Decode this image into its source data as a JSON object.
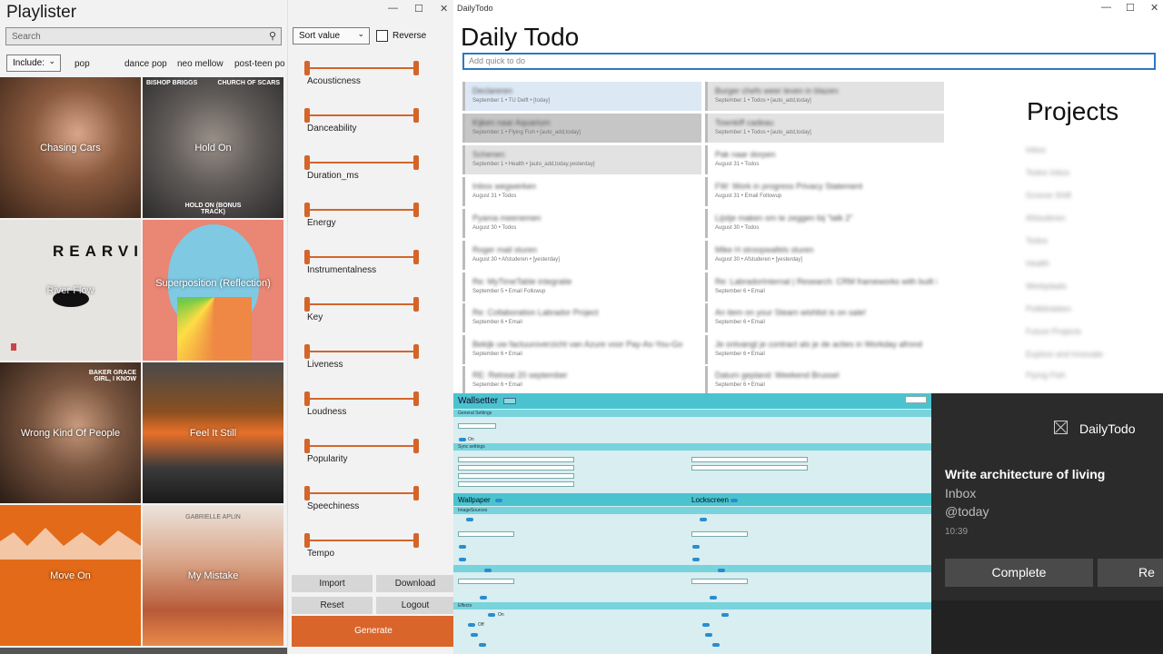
{
  "playlister": {
    "title": "Playlister",
    "search_placeholder": "Search",
    "include_label": "Include:",
    "genres": [
      "pop",
      "dance pop",
      "neo mellow",
      "post-teen po"
    ],
    "tiles": [
      {
        "label": "Chasing Cars"
      },
      {
        "label": "Hold On",
        "top_left": "BISHOP BRIGGS",
        "top_right": "CHURCH OF SCARS",
        "bottom": "HOLD ON (BONUS TRACK)"
      },
      {
        "label": "River Flow",
        "art": "REARVIO"
      },
      {
        "label": "Superposition (Reflection)"
      },
      {
        "label": "Wrong Kind Of People",
        "top_right": "BAKER GRACE GIRL, I KNOW"
      },
      {
        "label": "Feel It Still"
      },
      {
        "label": "Move On"
      },
      {
        "label": "My Mistake",
        "top": "GABRIELLE APLIN"
      }
    ]
  },
  "sortpanel": {
    "sort_value": "Sort value",
    "reverse_label": "Reverse",
    "sliders": [
      "Acousticness",
      "Danceability",
      "Duration_ms",
      "Energy",
      "Instrumentalness",
      "Key",
      "Liveness",
      "Loudness",
      "Popularity",
      "Speechiness",
      "Tempo"
    ],
    "buttons": {
      "import": "Import",
      "download": "Download",
      "reset": "Reset",
      "logout": "Logout",
      "generate": "Generate"
    }
  },
  "dailytodo": {
    "window_title": "DailyTodo",
    "title": "Daily Todo",
    "quick_placeholder": "Add quick to do",
    "projects_title": "Projects",
    "left_todos": [
      {
        "title": "Declareren",
        "meta": "September 1 • TU Delft • [today]"
      },
      {
        "title": "Kijken naar Aquarium",
        "meta": "September 1 • Flying Fish • [auto_add,today]"
      },
      {
        "title": "Schenen",
        "meta": "September 1 • Health • [auto_add,today,yesterday]"
      },
      {
        "title": "Inbox wegwerken",
        "meta": "August 31 • Todos"
      },
      {
        "title": "Pyama meenemen",
        "meta": "August 30 • Todos"
      },
      {
        "title": "Roger mail sturen",
        "meta": "August 30 • Afstuderen • [yesterday]"
      },
      {
        "title": "Re: MyTimeTable integratie",
        "meta": "September 5 • Email Followup"
      },
      {
        "title": "Re: Collaboration Labrador Project",
        "meta": "September 6 • Email"
      },
      {
        "title": "Bekijk uw factuuroverzicht van Azure voor Pay-As-You-Go",
        "meta": "September 6 • Email"
      },
      {
        "title": "RE: Retreat 20 september",
        "meta": "September 6 • Email"
      }
    ],
    "right_todos": [
      {
        "title": "Burger chefs weer leven in blazen",
        "meta": "September 1 • Todos • [auto_add,today]"
      },
      {
        "title": "Townkiff cadeau",
        "meta": "September 1 • Todos • [auto_add,today]"
      },
      {
        "title": "Pak naar dorpen",
        "meta": "August 31 • Todos"
      },
      {
        "title": "FW: Work in progress Privacy Statement",
        "meta": "August 31 • Email Followup"
      },
      {
        "title": "Lijstje maken om te zeggen bij \"talk 2\"",
        "meta": "August 30 • Todos"
      },
      {
        "title": "Mike H stroopwafels sturen",
        "meta": "August 30 • Afstuderen • [yesterday]"
      },
      {
        "title": "Re: LabradorInternal | Research: CRM frameworks with built in da",
        "meta": "September 6 • Email"
      },
      {
        "title": "An item on your Steam wishlist is on sale!",
        "meta": "September 6 • Email"
      },
      {
        "title": "Je ontvangt je contract als je de acties in Workday afrond",
        "meta": "September 6 • Email"
      },
      {
        "title": "Datum gepland: Weekend Brussel",
        "meta": "September 6 • Email"
      }
    ],
    "projects": [
      "Inbox",
      "Todos Inbox",
      "Groove Shift",
      "Afstuderen",
      "Todos",
      "Health",
      "Werkplaats",
      "Poliklinieken",
      "Future Projects",
      "Explore and Innovate",
      "Flying Fish"
    ]
  },
  "wallsetter": {
    "title": "Wallsetter",
    "general_settings": "General Settings",
    "sync_settings": "Sync settings",
    "wallpaper": "Wallpaper",
    "lockscreen": "Lockscreen",
    "image_sources": "ImageSources",
    "effects": "Effects",
    "toggle_on": "On",
    "toggle_off": "Off"
  },
  "toast": {
    "app": "DailyTodo",
    "title": "Write architecture of living",
    "line1": "Inbox",
    "line2": "@today",
    "time": "10:39",
    "complete": "Complete",
    "second_button": "Re"
  }
}
